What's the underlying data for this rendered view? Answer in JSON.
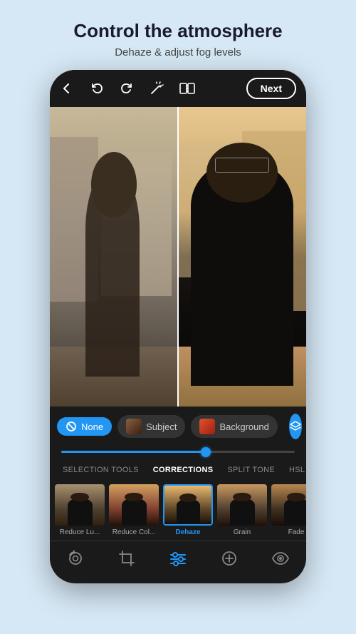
{
  "header": {
    "title": "Control the atmosphere",
    "subtitle": "Dehaze & adjust fog levels"
  },
  "topbar": {
    "next_label": "Next",
    "icons": {
      "back": "←",
      "undo": "↩",
      "redo": "↪",
      "magic": "✦",
      "compare": "⧉"
    }
  },
  "selection_bar": {
    "none_label": "None",
    "subject_label": "Subject",
    "background_label": "Background"
  },
  "slider": {
    "value": 62
  },
  "tabs": {
    "items": [
      {
        "label": "SELECTION TOOLS",
        "active": false
      },
      {
        "label": "CORRECTIONS",
        "active": true
      },
      {
        "label": "SPLIT TONE",
        "active": false
      },
      {
        "label": "HSL",
        "active": false
      }
    ]
  },
  "tools": [
    {
      "label": "Reduce Lu...",
      "active": false
    },
    {
      "label": "Reduce Col...",
      "active": false
    },
    {
      "label": "Dehaze",
      "active": true
    },
    {
      "label": "Grain",
      "active": false
    },
    {
      "label": "Fade",
      "active": false
    }
  ],
  "bottom_nav": {
    "icons": [
      "camera-rotate",
      "crop",
      "adjustments",
      "healing",
      "eye"
    ]
  }
}
